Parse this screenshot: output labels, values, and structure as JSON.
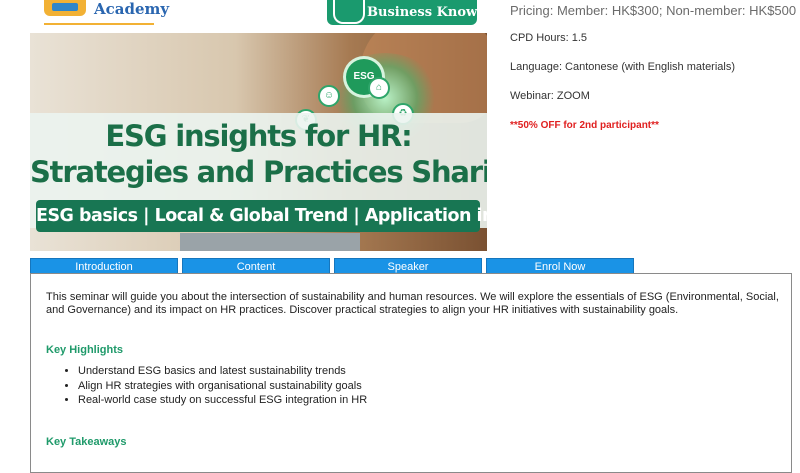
{
  "header": {
    "logo_text": "Academy",
    "badge_text": "Business Knowledge for HR",
    "badge_icon": "person-icon"
  },
  "hero": {
    "title_line1": "ESG insights for HR:",
    "title_line2": "Strategies and Practices Sharing",
    "subtitle": "ESG basics | Local & Global Trend | Application in HR",
    "esg_bubble": "ESG",
    "colors": {
      "title": "#1b6f48",
      "subtitle_bg": "#187653"
    }
  },
  "info": {
    "price": "Pricing: Member: HK$300; Non-member: HK$500",
    "cpd": "CPD Hours: 1.5",
    "language": "Language: Cantonese (with English materials)",
    "webinar": "Webinar: ZOOM",
    "discount": "**50% OFF for 2nd participant**"
  },
  "tabs": [
    {
      "label": "Introduction"
    },
    {
      "label": "Content"
    },
    {
      "label": "Speaker"
    },
    {
      "label": "Enrol Now"
    }
  ],
  "content": {
    "intro": "This seminar will guide you about the intersection of sustainability and human resources. We will explore the essentials of ESG (Environmental, Social, and Governance) and its impact on HR practices. Discover practical strategies to align your HR initiatives with sustainability goals.",
    "highlights_title": "Key Highlights",
    "highlights": [
      "Understand ESG basics and latest sustainability trends",
      "Align HR strategies with organisational sustainability goals",
      "Real-world case study on successful ESG integration in HR"
    ],
    "takeaways_title": "Key Takeaways"
  },
  "colors": {
    "tab": "#1a93e6",
    "accent": "#1f9a6a",
    "discount": "#e02020"
  }
}
